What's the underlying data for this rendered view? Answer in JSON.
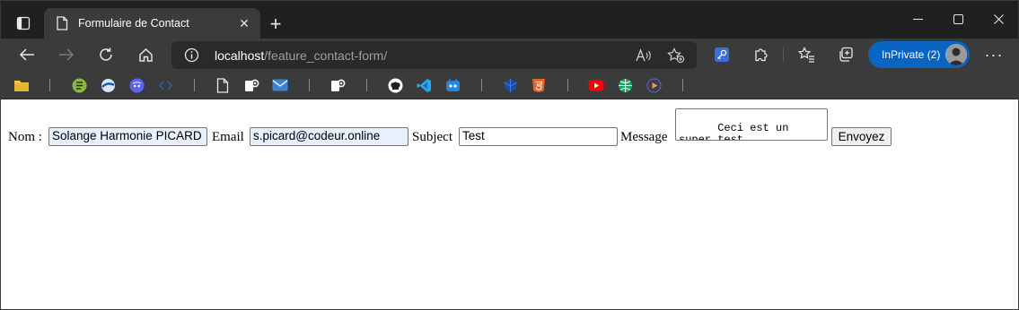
{
  "browser": {
    "tab_title": "Formulaire de Contact",
    "url_host": "localhost",
    "url_path": "/feature_contact-form/",
    "profile_label": "InPrivate (2)",
    "accent_color": "#0a64c2",
    "icons": {
      "tab_actions": "tab-actions-icon",
      "tab_favicon": "page-icon",
      "back": "back-arrow-icon",
      "forward": "forward-arrow-icon",
      "refresh": "refresh-icon",
      "home": "home-icon",
      "site_info": "info-icon",
      "read_aloud": "read-aloud-icon",
      "add_favorite": "add-favorite-icon",
      "extension_key": "key-extension-icon",
      "extensions": "puzzle-extensions-icon",
      "favorites": "favorites-icon",
      "collections": "collections-icon",
      "more": "more-icon"
    },
    "favorites_icons": [
      "folder-icon",
      "book-icon",
      "web-icon",
      "discord-icon",
      "code-icon",
      "page-icon",
      "settings-icon",
      "mail-icon",
      "settings-icon",
      "github-icon",
      "vscode-icon",
      "bot-icon",
      "cube-icon",
      "html5-icon",
      "youtube-icon",
      "globe-icon",
      "media-icon"
    ]
  },
  "form": {
    "name_label": "Nom :",
    "name_value": "Solange Harmonie PICARD",
    "email_label": "Email",
    "email_value": "s.picard@codeur.online",
    "subject_label": "Subject",
    "subject_value": "Test",
    "message_label": "Message",
    "message_value": "Ceci est un super test\n!",
    "submit_label": "Envoyez"
  }
}
